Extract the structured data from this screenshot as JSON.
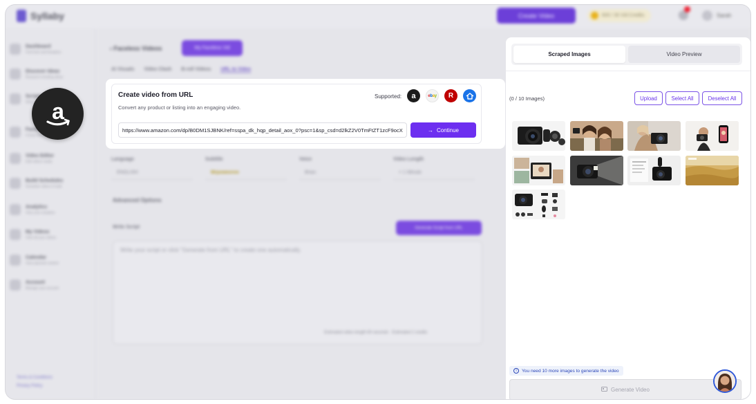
{
  "background": {
    "logo": "Syllaby",
    "create_video": "Create Video",
    "credits": "600 / 30 Vid Credits",
    "notifications_badge": "1",
    "user": "Sarah",
    "sidebar": [
      {
        "title": "Dashboard",
        "sub": "Overview and Analytics"
      },
      {
        "title": "Discover Ideas",
        "sub": "Research trending ideas"
      },
      {
        "title": "Scripts",
        "sub": "Write your scripts"
      },
      {
        "title": "Faceless Videos",
        "sub": "Create faceless videos"
      },
      {
        "title": "Video Editor",
        "sub": "Edit videos easily"
      },
      {
        "title": "Build Schedules",
        "sub": "Schedule videos in bulk"
      },
      {
        "title": "Analytics",
        "sub": "View your analytics"
      },
      {
        "title": "My Videos",
        "sub": "View all your videos"
      },
      {
        "title": "Calendar",
        "sub": "View planned content"
      },
      {
        "title": "Account",
        "sub": "Manage your account"
      }
    ],
    "footer_links": [
      "Terms & Conditions",
      "Privacy Policy"
    ],
    "page_title": "Faceless Videos",
    "header_button": "My Faceless Vid",
    "tabs": [
      "AI Visuals",
      "Video Clash",
      "B-roll Videos",
      "URL to Video"
    ],
    "fields": [
      {
        "label": "Language",
        "value": "ENGLISH"
      },
      {
        "label": "Subtitle",
        "value": "Mrpoweeree"
      },
      {
        "label": "Voice",
        "value": "Brian"
      },
      {
        "label": "Video Length",
        "value": "< 1 Minute"
      }
    ],
    "advanced_options": "Advanced Options",
    "script_label": "Write Script",
    "generate_script": "Generate Script from URL",
    "script_placeholder": "Write your script or click \"Generate from URL\" to create one automatically.",
    "estimate": "Estimated video length 60 seconds  ·  Estimated 2 credits"
  },
  "card": {
    "title": "Create video from URL",
    "subtitle": "Convert any product or listing into an engaging video.",
    "supported_label": "Supported:",
    "url": "https://www.amazon.com/dp/B0DM1SJBNK/ref=sspa_dk_hqp_detail_aox_0?psc=1&sp_csd=d2lkZ2V0TmFtZT1zcF9ocXBfc2hhcmVk",
    "continue": "Continue"
  },
  "panel": {
    "tab_scraped": "Scraped Images",
    "tab_preview": "Video Preview",
    "image_count": "(0 / 10 Images)",
    "upload": "Upload",
    "select_all": "Select All",
    "deselect_all": "Deselect All",
    "thumbnails": [
      "camera-with-lens-kit",
      "two-women-selfie",
      "woman-holding-camera",
      "man-filming-with-camera",
      "camera-screen-views",
      "camera-flash-light",
      "camera-with-microphone",
      "wheat-field-photo",
      "camera-accessories-set"
    ],
    "notice": "You need 10 more images to generate the video",
    "generate": "Generate Video"
  },
  "colors": {
    "accent": "#6d2ff0",
    "notice_text": "#2b46b8",
    "amazon": "#232323"
  }
}
